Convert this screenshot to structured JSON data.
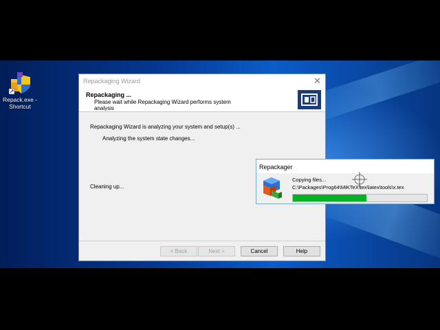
{
  "desktop": {
    "shortcut_label_line1": "Repack.exe -",
    "shortcut_label_line2": "Shortcut"
  },
  "wizard": {
    "title": "Repackaging Wizard",
    "close_glyph": "✕",
    "header_title": "Repackaging ...",
    "header_subtitle": "Please wait while Repackaging Wizard performs system analysis",
    "status_line": "Repackaging Wizard is analyzing your system and setup(s) ...",
    "step_line": "Analyzing the system state changes...",
    "cleanup_line": "Cleaning up...",
    "buttons": {
      "back": "< Back",
      "next": "Next >",
      "cancel": "Cancel",
      "help": "Help"
    }
  },
  "popup": {
    "title": "Repackager",
    "status": "Copying files...",
    "path": "C:\\Packages\\Prog64\\MiKTeX\\tex\\latex\\tools\\x.tex",
    "progress": 0.55
  },
  "colors": {
    "progress_fill": "#06b025",
    "logo_bg": "#1a3c78"
  },
  "icons": {
    "shortcut": "shield-box-icon",
    "wizard_logo": "repackager-logo-icon",
    "popup": "package-cubes-icon",
    "cursor": "crosshair-icon"
  }
}
